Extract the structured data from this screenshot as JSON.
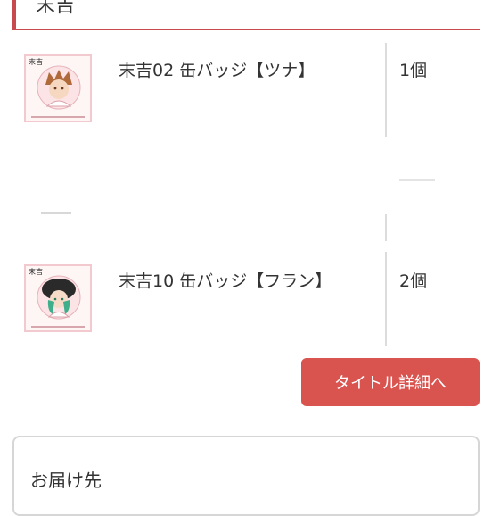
{
  "section": {
    "title": "末吉"
  },
  "items": [
    {
      "name": "末吉02 缶バッジ【ツナ】",
      "quantity": "1個",
      "thumb_corner": "末吉"
    },
    {
      "name": "末吉10 缶バッジ【フラン】",
      "quantity": "2個",
      "thumb_corner": "末吉"
    }
  ],
  "actions": {
    "detail_button": "タイトル詳細へ"
  },
  "delivery": {
    "title": "お届け先"
  },
  "colors": {
    "accent": "#d9534f",
    "header_border": "#c94a4e",
    "thumb_border": "#f2c9cf"
  }
}
